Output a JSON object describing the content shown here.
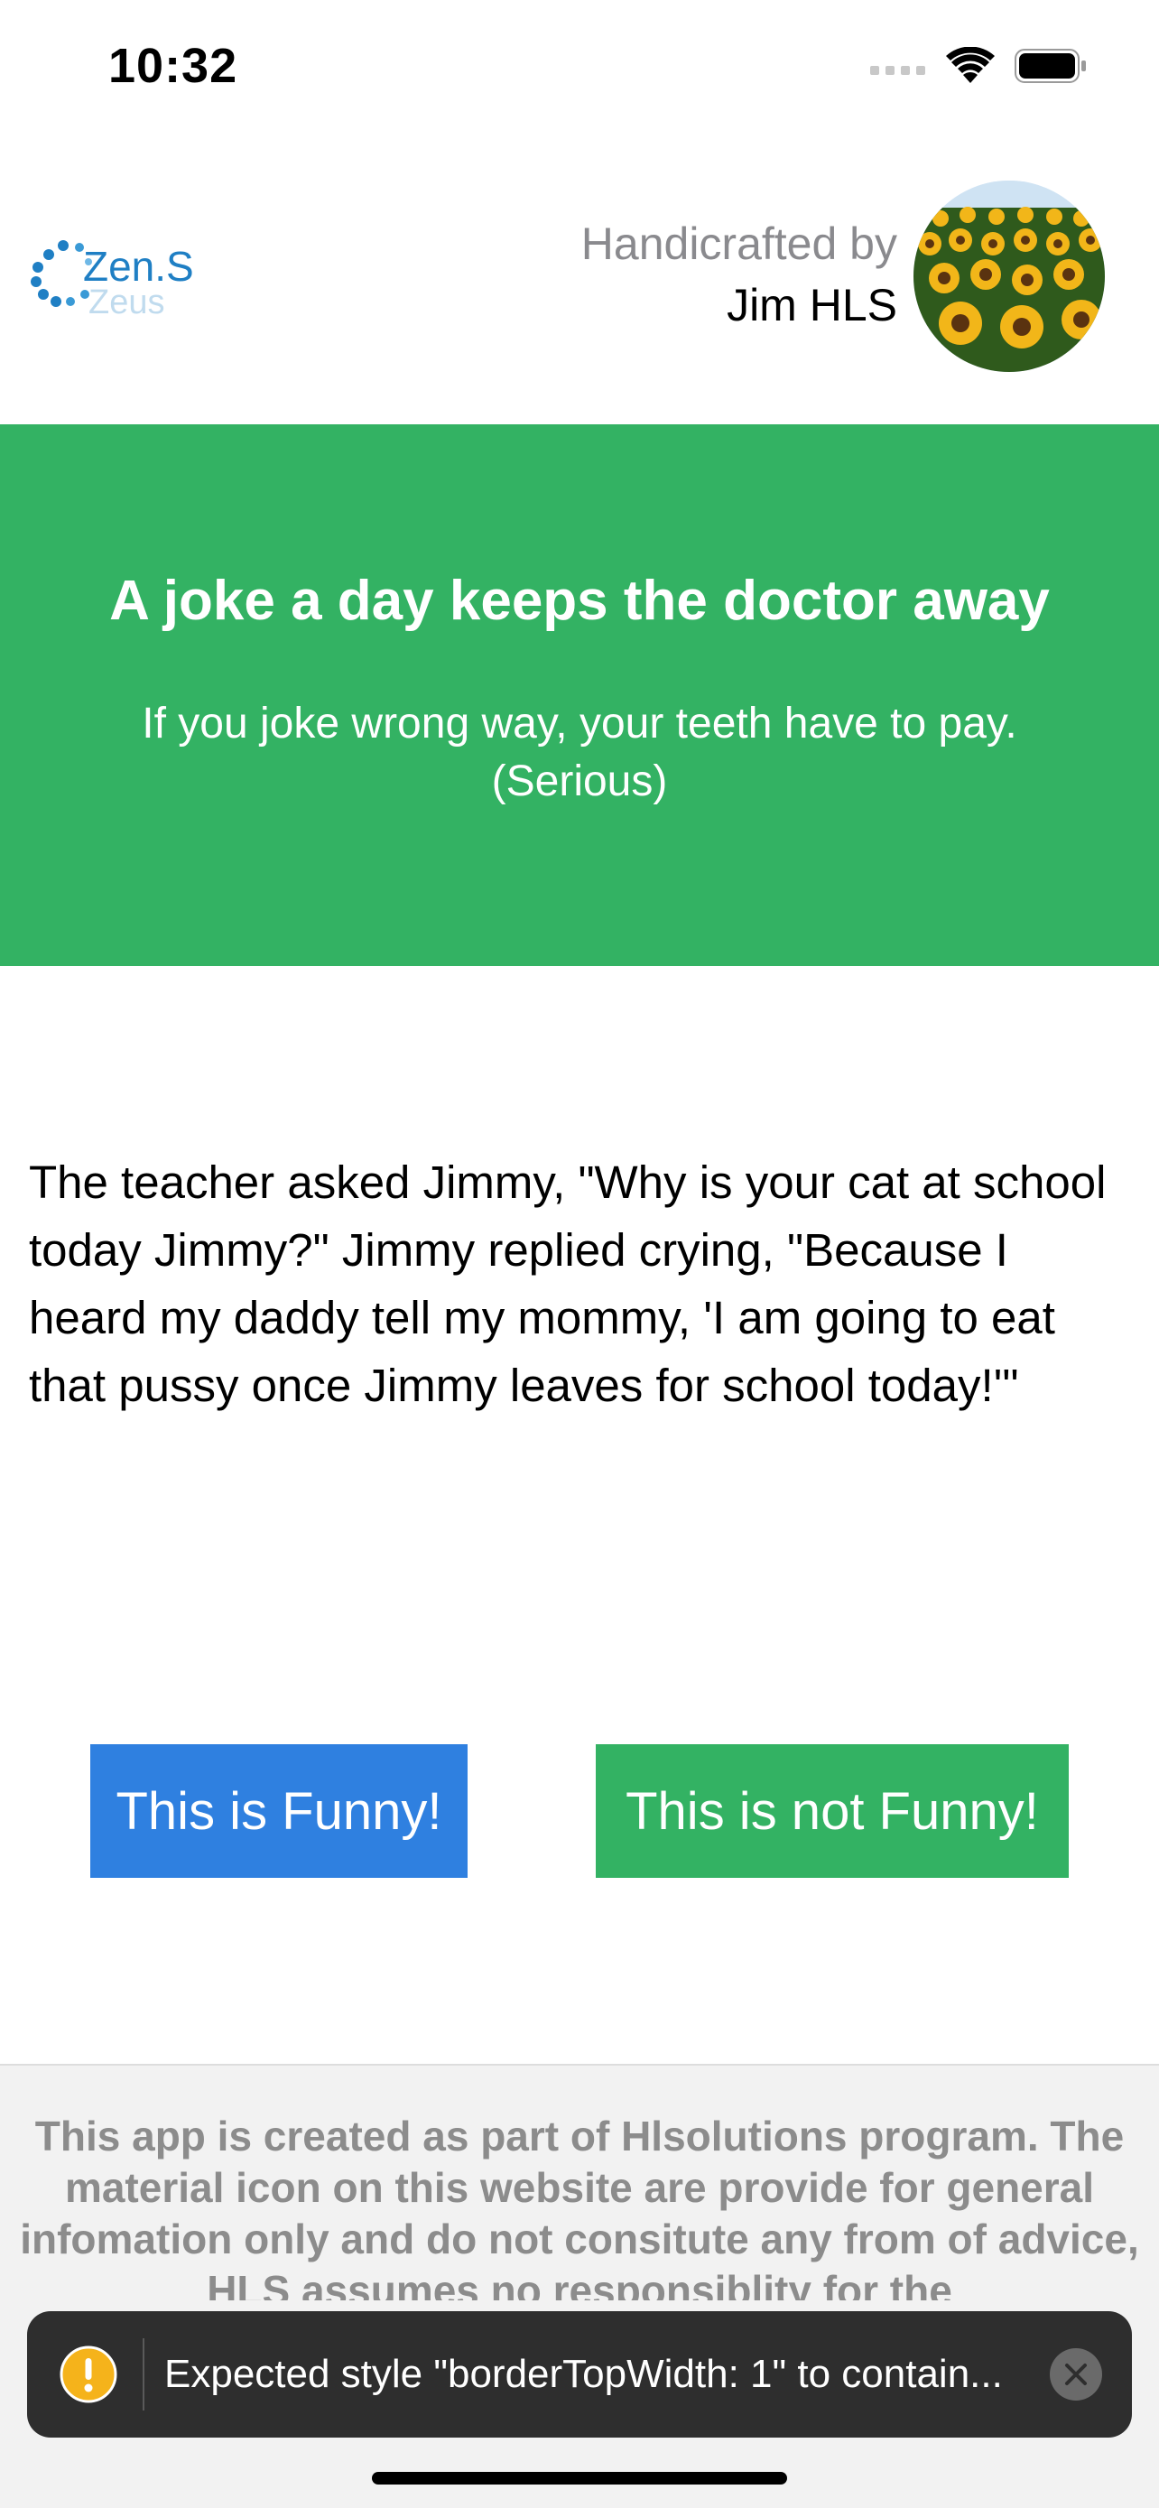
{
  "status_bar": {
    "time": "10:32",
    "icons": [
      "signal-icon",
      "wifi-icon",
      "battery-icon"
    ]
  },
  "header": {
    "logo": {
      "text": "Zen.S",
      "reflection_text": "Zeus",
      "icon": "dots-ring-logo-icon",
      "color": "#1f7fc4",
      "accent_color": "#e8452c"
    },
    "credits": {
      "label": "Handicrafted by",
      "name": "Jim HLS"
    },
    "avatar": {
      "icon": "sunflower-field-avatar"
    }
  },
  "hero": {
    "background": "#33b263",
    "title": "A joke a day keeps the doctor away",
    "subtitle_line1": "If you joke wrong way, your teeth have to pay.",
    "subtitle_line2": "(Serious)"
  },
  "joke": {
    "text": "The teacher asked Jimmy, \"Why is your cat at school today Jimmy?\" Jimmy replied crying, \"Because I heard my daddy tell my mommy, 'I am going to eat that pussy once Jimmy leaves for school today!'\""
  },
  "actions": {
    "funny_label": "This is Funny!",
    "funny_color": "#2f80e0",
    "not_funny_label": "This is not Funny!",
    "not_funny_color": "#33b263"
  },
  "footer": {
    "text": "This app is created as part of Hlsolutions program. The material icon on this website are provide for general infomation only and do not consitute any from of advice, HLS assumes no responsiblity for the"
  },
  "toast": {
    "icon": "warning-icon",
    "icon_color": "#f5b31b",
    "message": "Expected style \"borderTopWidth: 1\" to contain...",
    "close_icon": "close-icon"
  }
}
